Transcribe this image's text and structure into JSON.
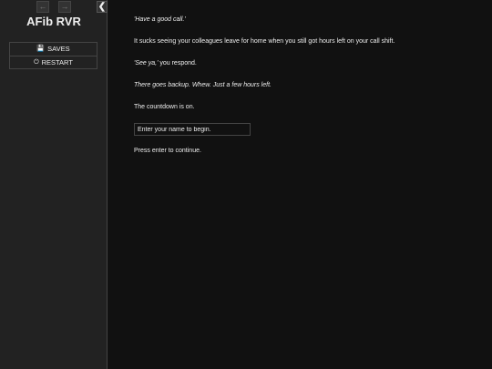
{
  "sidebar": {
    "back_icon": "←",
    "forward_icon": "→",
    "toggle_icon": "❮",
    "title": "AFib RVR",
    "menu": [
      {
        "icon": "💾",
        "label": "SAVES"
      },
      {
        "icon": "⏻",
        "label": "RESTART"
      }
    ]
  },
  "passage": {
    "line1": "'Have a good call.'",
    "line2": "It sucks seeing your colleagues leave for home when you still got hours left on your call shift.",
    "line3_quote": "'See ya,'",
    "line3_rest": " you respond.",
    "line4": "There goes backup. Whew. Just a few hours left.",
    "line5": "The countdown is on.",
    "input_placeholder": "Enter your name to begin.",
    "line6": "Press enter to continue."
  }
}
